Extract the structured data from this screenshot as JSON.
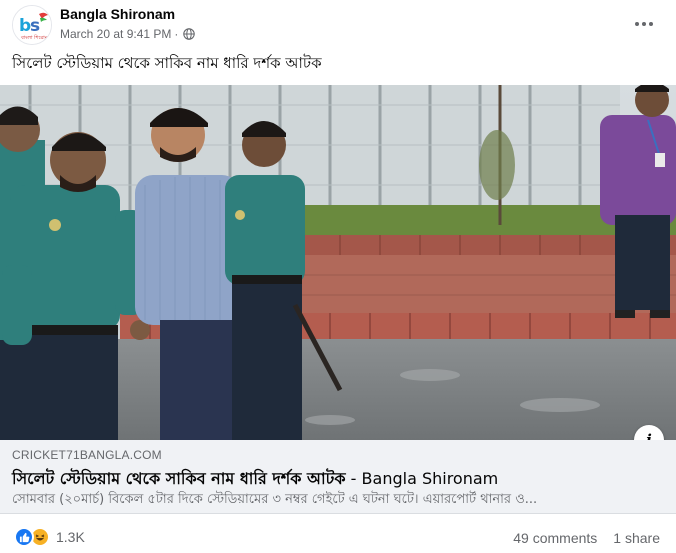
{
  "post": {
    "page_name": "Bangla Shironam",
    "timestamp": "March 20 at 9:41 PM",
    "separator": "·",
    "audience_icon": "globe-icon",
    "menu_icon": "more-horizontal-icon",
    "logo_text": "BS",
    "logo_sub": "বাংলা শিরোনাম",
    "text": "সিলেট স্টেডিয়াম থেকে সাকিব নাম ধারি দর্শক আটক"
  },
  "link": {
    "domain": "CRICKET71BANGLA.COM",
    "title": "সিলেট স্টেডিয়াম থেকে সাকিব নাম ধারি দর্শক আটক",
    "title_sep": " - ",
    "site": "Bangla Shironam",
    "description": "সোমবার (২০মার্চ) বিকেল ৫টার দিকে স্টেডিয়ামের ৩ নম্বর গেইটে এ ঘটনা ঘটে। এয়ারপোর্ট থানার ও...",
    "info_label": "i"
  },
  "engagement": {
    "reaction_icons": [
      "like-icon",
      "haha-icon"
    ],
    "reaction_count": "1.3K",
    "comments": "49 comments",
    "shares": "1 share"
  },
  "colors": {
    "fb_blue": "#1877f2",
    "haha_yellow": "#f7b125",
    "secondary_text": "#65676b",
    "preview_bg": "#f0f2f5",
    "uniform_teal": "#2f7f7c",
    "shirt_purple": "#7b4a9a"
  }
}
